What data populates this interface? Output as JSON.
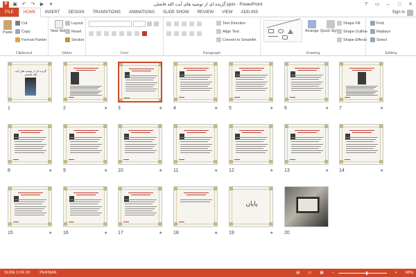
{
  "window": {
    "title": "گزیده ای از توصیه های آیت الله فاضلی.pptx - PowerPoint",
    "app_icon": "P",
    "controls": [
      "?",
      "▭",
      "–",
      "□",
      "✕"
    ]
  },
  "quick_access": [
    "save-icon",
    "undo-icon",
    "redo-icon",
    "start-from-beginning-icon",
    "customize-icon"
  ],
  "tabs": [
    {
      "label": "FILE"
    },
    {
      "label": "HOME"
    },
    {
      "label": "INSERT"
    },
    {
      "label": "DESIGN"
    },
    {
      "label": "TRANSITIONS"
    },
    {
      "label": "ANIMATIONS"
    },
    {
      "label": "SLIDE SHOW"
    },
    {
      "label": "REVIEW"
    },
    {
      "label": "VIEW"
    },
    {
      "label": "ADD-INS"
    }
  ],
  "active_tab": "HOME",
  "account": {
    "sign_in": "Sign in"
  },
  "ribbon": {
    "clipboard": {
      "label": "Clipboard",
      "paste": "Paste",
      "cut": "Cut",
      "copy": "Copy",
      "format_painter": "Format Painter"
    },
    "slides": {
      "label": "Slides",
      "new_slide": "New Slide",
      "layout": "Layout",
      "reset": "Reset",
      "section": "Section"
    },
    "font": {
      "label": "Font",
      "font_name": "",
      "font_size": ""
    },
    "paragraph": {
      "label": "Paragraph",
      "text_direction": "Text Direction",
      "align_text": "Align Text",
      "convert_smartart": "Convert to SmartArt"
    },
    "drawing": {
      "label": "Drawing",
      "arrange": "Arrange",
      "quick_styles": "Quick Styles",
      "shape_fill": "Shape Fill",
      "shape_outline": "Shape Outline",
      "shape_effects": "Shape Effects"
    },
    "editing": {
      "label": "Editing",
      "find": "Find",
      "replace": "Replace",
      "select": "Select"
    }
  },
  "slides": [
    {
      "number": "1",
      "title": "گزیده ای از توصیه های آیت الله فاضلی",
      "star": false,
      "kind": "title",
      "selected": false
    },
    {
      "number": "2",
      "star": true,
      "kind": "portrait-text",
      "selected": false
    },
    {
      "number": "3",
      "star": true,
      "kind": "text",
      "selected": true
    },
    {
      "number": "4",
      "star": true,
      "kind": "text",
      "selected": false
    },
    {
      "number": "5",
      "star": true,
      "kind": "text",
      "selected": false
    },
    {
      "number": "6",
      "star": true,
      "kind": "text",
      "selected": false
    },
    {
      "number": "7",
      "star": true,
      "kind": "text-portrait",
      "selected": false
    },
    {
      "number": "8",
      "star": true,
      "kind": "text",
      "selected": false
    },
    {
      "number": "9",
      "star": true,
      "kind": "text",
      "selected": false
    },
    {
      "number": "10",
      "star": true,
      "kind": "text",
      "selected": false
    },
    {
      "number": "11",
      "star": true,
      "kind": "text",
      "selected": false
    },
    {
      "number": "12",
      "star": true,
      "kind": "text",
      "selected": false
    },
    {
      "number": "13",
      "star": true,
      "kind": "text",
      "selected": false
    },
    {
      "number": "14",
      "star": true,
      "kind": "text",
      "selected": false
    },
    {
      "number": "15",
      "star": true,
      "kind": "text",
      "selected": false
    },
    {
      "number": "16",
      "star": true,
      "kind": "text",
      "selected": false
    },
    {
      "number": "17",
      "star": true,
      "kind": "text",
      "selected": false
    },
    {
      "number": "18",
      "star": true,
      "kind": "text-short",
      "selected": false
    },
    {
      "number": "19",
      "title": "پایان",
      "star": true,
      "kind": "end",
      "selected": false
    },
    {
      "number": "20",
      "star": false,
      "kind": "photo",
      "selected": false
    }
  ],
  "status": {
    "slide_indicator": "SLIDE 3 OF 20",
    "language": "PERSIAN",
    "zoom": "68%"
  },
  "colors": {
    "accent": "#d04727",
    "selected_border": "#d04727"
  }
}
